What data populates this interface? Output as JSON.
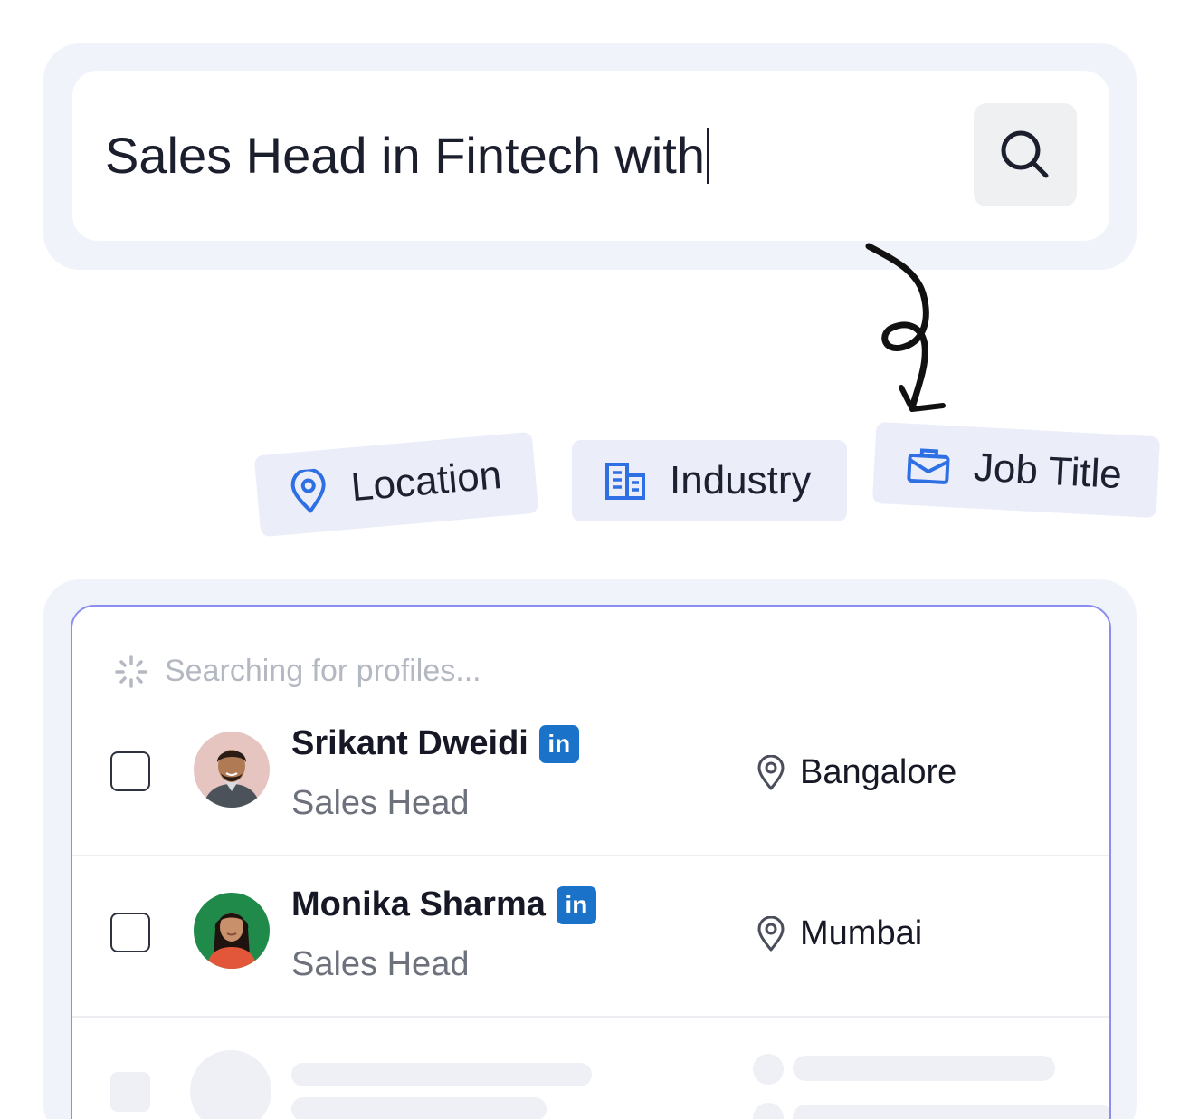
{
  "search": {
    "query": "Sales Head in Fintech with"
  },
  "filters": [
    {
      "label": "Location",
      "icon": "location-pin-icon"
    },
    {
      "label": "Industry",
      "icon": "building-icon"
    },
    {
      "label": "Job Title",
      "icon": "briefcase-icon"
    }
  ],
  "results": {
    "status": "Searching for profiles...",
    "profiles": [
      {
        "name": "Srikant Dweidi",
        "role": "Sales Head",
        "location": "Bangalore",
        "badge": "in"
      },
      {
        "name": "Monika Sharma",
        "role": "Sales Head",
        "location": "Mumbai",
        "badge": "in"
      }
    ]
  },
  "colors": {
    "accent": "#2f6fe4",
    "linkedin": "#1a73c8",
    "card_border": "#8b8ef0"
  }
}
